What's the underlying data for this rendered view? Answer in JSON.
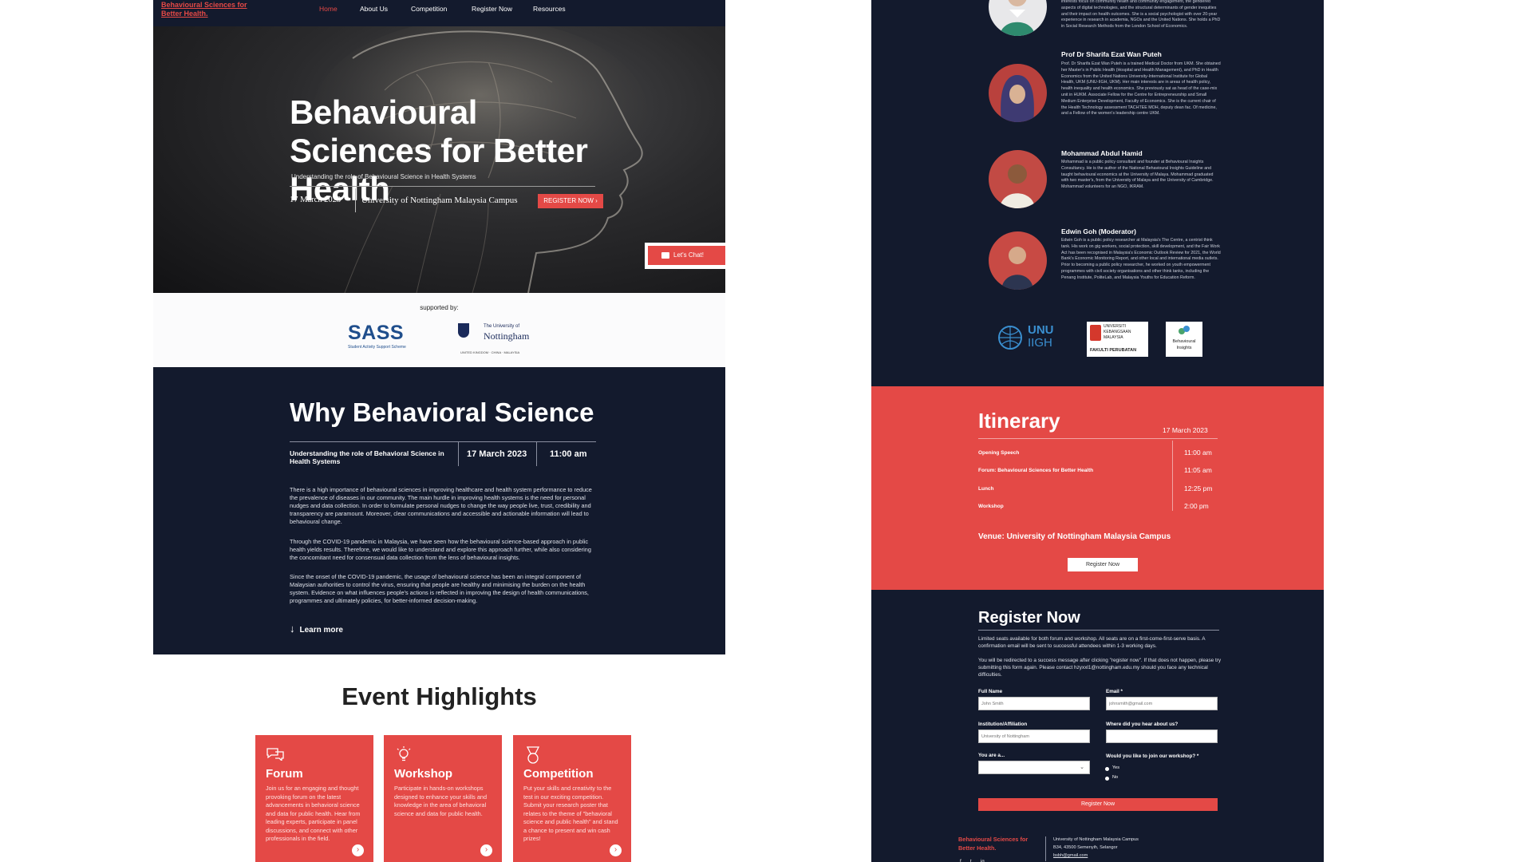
{
  "nav": {
    "logo": "Behavioural Sciences for Better Health.",
    "items": [
      "Home",
      "About Us",
      "Competition",
      "Register Now",
      "Resources"
    ],
    "active": "Home"
  },
  "hero": {
    "title": "Behavioural Sciences for Better Health",
    "subtitle": "Understanding the role of Behavioural Science in Health Systems",
    "date": "17 March 2023",
    "venue": "University of Nottingham Malaysia Campus",
    "register_label": "REGISTER NOW ›"
  },
  "chat": {
    "label": "Let's Chat!"
  },
  "support": {
    "label": "supported by:",
    "sass": {
      "name": "SASS",
      "tagline": "Student Activity Support Scheme"
    },
    "nottingham": {
      "line1": "The University of",
      "line2": "Nottingham",
      "line3": "UNITED KINGDOM · CHINA · MALAYSIA"
    }
  },
  "why": {
    "title": "Why Behavioral Science",
    "meta_title": "Understanding the role of Behavioral Science in Health Systems",
    "meta_date": "17 March 2023",
    "meta_time": "11:00 am",
    "paragraphs": [
      "There is a high importance of behavioural sciences in improving healthcare and health system performance to reduce the prevalence of diseases in our community. The main hurdle in improving health systems is the need for personal nudges and data collection. In order to formulate personal nudges to change the way people live, trust, credibility and transparency are paramount. Moreover, clear communications and accessible and actionable information will lead to behavioural change.",
      "Through the COVID-19 pandemic in Malaysia, we have seen how the behavioural science-based approach in public health yields results. Therefore, we would like to understand and explore this approach further, while also considering the concomitant need for consensual data collection from the lens of behavioural insights.",
      "Since the onset of the COVID-19 pandemic, the usage of behavioural science has been an integral component of Malaysian authorities to control the virus, ensuring that people are healthy and minimising the burden on the health system. Evidence on what influences people's actions is reflected in improving the design of health communications, programmes and ultimately policies, for better-informed decision-making."
    ],
    "learn_more": "Learn more"
  },
  "highlights": {
    "title": "Event Highlights",
    "cards": [
      {
        "title": "Forum",
        "desc": "Join us for an engaging and thought provoking forum on the latest advancements in behavioral science and data for public health. Hear from leading experts, participate in panel discussions, and connect with other professionals in the field."
      },
      {
        "title": "Workshop",
        "desc": "Participate in hands-on workshops designed to enhance your skills and knowledge in the area of behavioral science and data for public health."
      },
      {
        "title": "Competition",
        "desc": "Put your skills and creativity to the test in our exciting competition. Submit your research poster that relates to the theme of \"behavioral science and public health\" and stand a chance to present and win cash prizes!"
      }
    ]
  },
  "speakers": [
    {
      "name": "",
      "bio": "interests focus on community health and community engagement, the gendered aspects of digital technologies, and the structural determinants of gender inequities and their impact on health outcomes. She is a social psychologist with over 20-year experience in research in academia, NGOs and the United Nations. She holds a PhD in Social Research Methods from the London School of Economics."
    },
    {
      "name": "Prof Dr Sharifa Ezat Wan Puteh",
      "bio": "Prof. Dr Sharifa Ezat Wan Puteh is a trained Medical Doctor from UKM. She obtained her Master's in Public Health (Hospital and Health Management), and PhD in Health Economics from the United Nations University-International Institute for Global Health, UKM (UNU-IIGH, UKM). Her main interests are in areas of health policy, health inequality and health economics. She previously sat as head of the case-mix unit in HUKM. Associate Fellow for the Centre for Entrepreneurship and Small Medium Enterprise Development, Faculty of Economics. She is the current chair of the Health Technology assessment TACHTEE MOH, deputy dean fac. Of medicine, and a Fellow of the women's leadership centre UKM."
    },
    {
      "name": "Mohammad Abdul Hamid",
      "bio": "Mohammad is a public policy consultant and founder at Behavioural Insights Consultancy. He is the author of the National Behavioural Insights Guideline and taught behavioural economics at the University of Malaya. Mohammad graduated with two master's, from the University of Malaya and the University of Cambridge. Mohammad volunteers for an NGO, IKRAM."
    },
    {
      "name": "Edwin Goh (Moderator)",
      "bio": "Edwin Goh is a public policy researcher at Malaysia's The Centre, a centrist think tank. His work on gig workers, social protection, skill development, and the Fair Work Act has been recognised in Malaysia's Economic Outlook Review for 2021, the World Bank's Economic Monitoring Report, and other local and international media outlets. Prior to becoming a public policy researcher, he worked on youth empowerment programmes with civil society organisations and other think tanks, including the Penang Institute, PoliteLab, and Malaysia Youths for Education Reform."
    }
  ],
  "partners": {
    "unu": {
      "line1": "UNU",
      "line2": "IIGH"
    },
    "ukm": {
      "line1": "UNIVERSITI",
      "line2": "KEBANGSAAN",
      "line3": "MALAYSIA",
      "line4": "FAKULTI PERUBATAN"
    },
    "bi": {
      "line1": "Behavioural",
      "line2": "Insights"
    }
  },
  "itinerary": {
    "title": "Itinerary",
    "date": "17 March 2023",
    "events": [
      {
        "name": "Opening Speech",
        "time": "11:00 am"
      },
      {
        "name": "Forum: Behavioural Sciences for Better Health",
        "time": "11:05 am"
      },
      {
        "name": "Lunch",
        "time": "12:25 pm"
      },
      {
        "name": "Workshop",
        "time": "2:00 pm"
      }
    ],
    "venue": "Venue: University of Nottingham Malaysia Campus",
    "register_label": "Register Now"
  },
  "register": {
    "title": "Register Now",
    "p1": "Limited seats available for both forum and workshop. All seats are on a first-come-first-serve basis. A confirmation email will be sent to successful attendees within 1-3 working days.",
    "p2": "You will be redirected to a success message after clicking \"register now\". If that does not happen, please try submitting this form again. Please contact hzyxxl1@nottingham.edu.my should you face any technical difficulties.",
    "full_name_label": "Full Name",
    "full_name_placeholder": "John Smith",
    "email_label": "Email *",
    "email_placeholder": "johnsmith@gmail.com",
    "institution_label": "Institution/Affiliation",
    "institution_placeholder": "University of Nottingham",
    "hear_label": "Where did you hear about us?",
    "you_are_label": "You are a...",
    "workshop_label": "Would you like to join our workshop? *",
    "yes": "Yes",
    "no": "No",
    "submit_label": "Register Now"
  },
  "footer": {
    "logo": "Behavioural Sciences for Better Health.",
    "address1": "University of Nottingham Malaysia Campus",
    "address2": "B34, 43500 Semenyih, Selangor",
    "email": "bsbh@gmail.com",
    "social": [
      "f",
      "t",
      "ig"
    ]
  },
  "colors": {
    "accent": "#e44946",
    "navy": "#131a2d"
  }
}
